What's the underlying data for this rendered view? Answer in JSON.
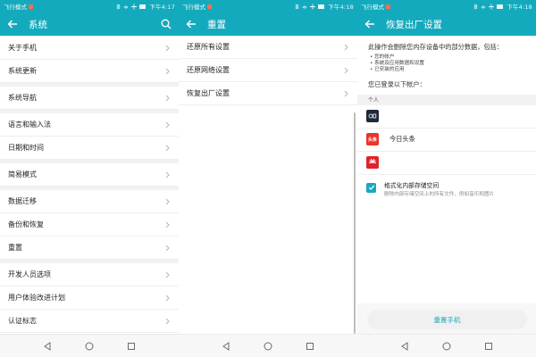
{
  "status_bar": {
    "panels": [
      {
        "mode": "飞行模式",
        "time": "下午4:17"
      },
      {
        "mode": "飞行模式",
        "time": "下午4:18"
      },
      {
        "mode": "飞行模式",
        "time": "下午4:18"
      }
    ]
  },
  "colors": {
    "accent": "#14aabd",
    "button_text": "#1aa7bf",
    "toutiao_red": "#e8362c",
    "huawei_red": "#e1232b",
    "id_dark": "#1d2a3a"
  },
  "panel1": {
    "title": "系统",
    "groups": [
      [
        "关于手机",
        "系统更新"
      ],
      [
        "系统导航"
      ],
      [
        "语言和输入法",
        "日期和时间"
      ],
      [
        "简易模式"
      ],
      [
        "数据迁移",
        "备份和恢复",
        "重置"
      ],
      [
        "开发人员选项",
        "用户体验改进计划",
        "认证标志"
      ]
    ]
  },
  "panel2": {
    "title": "重置",
    "items": [
      "还原所有设置",
      "还原网络设置",
      "恢复出厂设置"
    ]
  },
  "panel3": {
    "title": "恢复出厂设置",
    "description": "此操作会删除您内存设备中的部分数据，包括：",
    "bullets": [
      "• 您的帐户",
      "• 系统及应用数据和设置",
      "• 已安装的应用"
    ],
    "logged_in_text": "您已登录以下帐户：",
    "section_header": "个人",
    "accounts": [
      {
        "icon": "account-id-icon",
        "name": ""
      },
      {
        "icon": "toutiao-icon",
        "icon_text": "头条",
        "name": "今日头条"
      },
      {
        "icon": "huawei-icon",
        "name": ""
      }
    ],
    "format_checkbox": {
      "checked": true,
      "title": "格式化内部存储空间",
      "subtitle": "删除内部存储空间上的所有文件，例如音乐和图片"
    },
    "reset_button": "重置手机"
  }
}
